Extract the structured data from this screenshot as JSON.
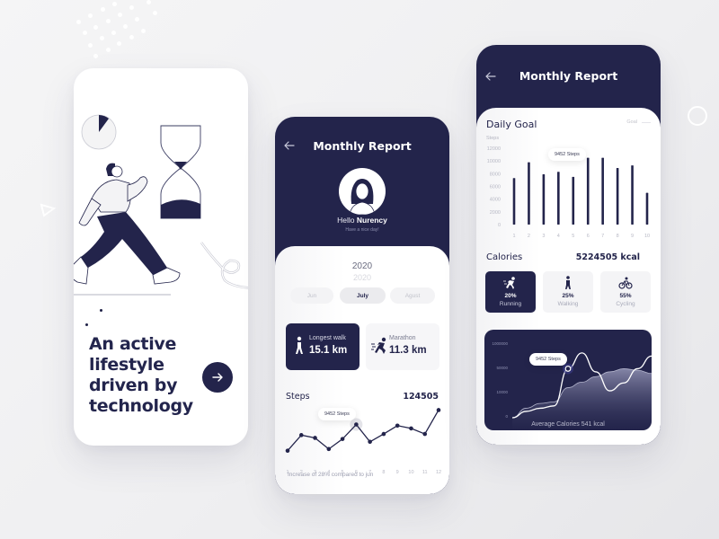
{
  "theme": {
    "primary": "#23244b",
    "background": "#f2f2f4",
    "card": "#ffffff",
    "muted": "#9c9eb0"
  },
  "onboarding": {
    "headline_lines": [
      "An active",
      "lifestyle",
      "driven by",
      "technology"
    ],
    "next_icon": "arrow-right-icon",
    "illustration": "walking-person-with-hourglass"
  },
  "monthly_report_profile": {
    "title": "Monthly Report",
    "back_icon": "arrow-left-icon",
    "greeting_prefix": "Hello",
    "user_name": "Nurency",
    "subtitle": "Have a nice day!",
    "year": "2020",
    "year_next": "2020",
    "months": [
      {
        "label": "Jun",
        "active": false
      },
      {
        "label": "July",
        "active": true
      },
      {
        "label": "Agust",
        "active": false
      }
    ],
    "stats": [
      {
        "label": "Longest walk",
        "value": "15.1 km",
        "icon": "walking-icon",
        "highlighted": true
      },
      {
        "label": "Marathon",
        "value": "11.3 km",
        "icon": "running-icon",
        "highlighted": false
      }
    ],
    "steps": {
      "title": "Steps",
      "total": "124505",
      "tooltip": "9452 Steps",
      "note": "Increase of 28% compared to jun"
    }
  },
  "monthly_report_goals": {
    "title": "Monthly Report",
    "back_icon": "arrow-left-icon",
    "daily_goal": {
      "title": "Daily Goal",
      "legend_label": "Goal",
      "y_axis_label": "Steps",
      "tooltip": "9452 Steps"
    },
    "calories": {
      "title": "Calories",
      "total": "5224505 kcal",
      "activities": [
        {
          "pct": "20%",
          "name": "Running",
          "icon": "running-icon",
          "highlighted": true
        },
        {
          "pct": "25%",
          "name": "Walking",
          "icon": "walking-icon",
          "highlighted": false
        },
        {
          "pct": "55%",
          "name": "Cycling",
          "icon": "cycling-icon",
          "highlighted": false
        }
      ]
    },
    "area_chart": {
      "tooltip": "9452 Steps",
      "caption": "Average Calories 541 kcal"
    }
  },
  "chart_data": [
    {
      "id": "steps",
      "type": "line",
      "title": "Steps",
      "x": [
        "1",
        "2",
        "3",
        "4",
        "5",
        "6",
        "7",
        "8",
        "9",
        "10",
        "11",
        "12"
      ],
      "values": [
        15,
        43,
        38,
        18,
        36,
        62,
        31,
        45,
        60,
        55,
        45,
        88
      ],
      "ylim": [
        0,
        100
      ],
      "highlight_index": 5,
      "grid": false
    },
    {
      "id": "daily_goal",
      "type": "bar",
      "title": "Daily Goal",
      "ylabel": "Steps",
      "categories": [
        "1",
        "2",
        "3",
        "4",
        "5",
        "6",
        "7",
        "8",
        "9",
        "10"
      ],
      "values": [
        7300,
        9800,
        7900,
        8300,
        7500,
        10500,
        10500,
        8900,
        9300,
        5000
      ],
      "yticks": [
        0,
        2000,
        4000,
        6000,
        8000,
        10000,
        12000
      ],
      "ylim": [
        0,
        12000
      ],
      "grid": false
    },
    {
      "id": "average_calories",
      "type": "area",
      "yticks": [
        "0",
        "10000",
        "50000",
        "1000000"
      ],
      "series": [
        {
          "name": "line",
          "values": [
            0,
            8,
            12,
            15,
            62,
            82,
            58,
            34,
            44,
            62,
            78
          ]
        },
        {
          "name": "area",
          "values": [
            0,
            12,
            18,
            20,
            38,
            45,
            52,
            58,
            62,
            60,
            56
          ]
        }
      ],
      "highlight_index": 4
    }
  ]
}
